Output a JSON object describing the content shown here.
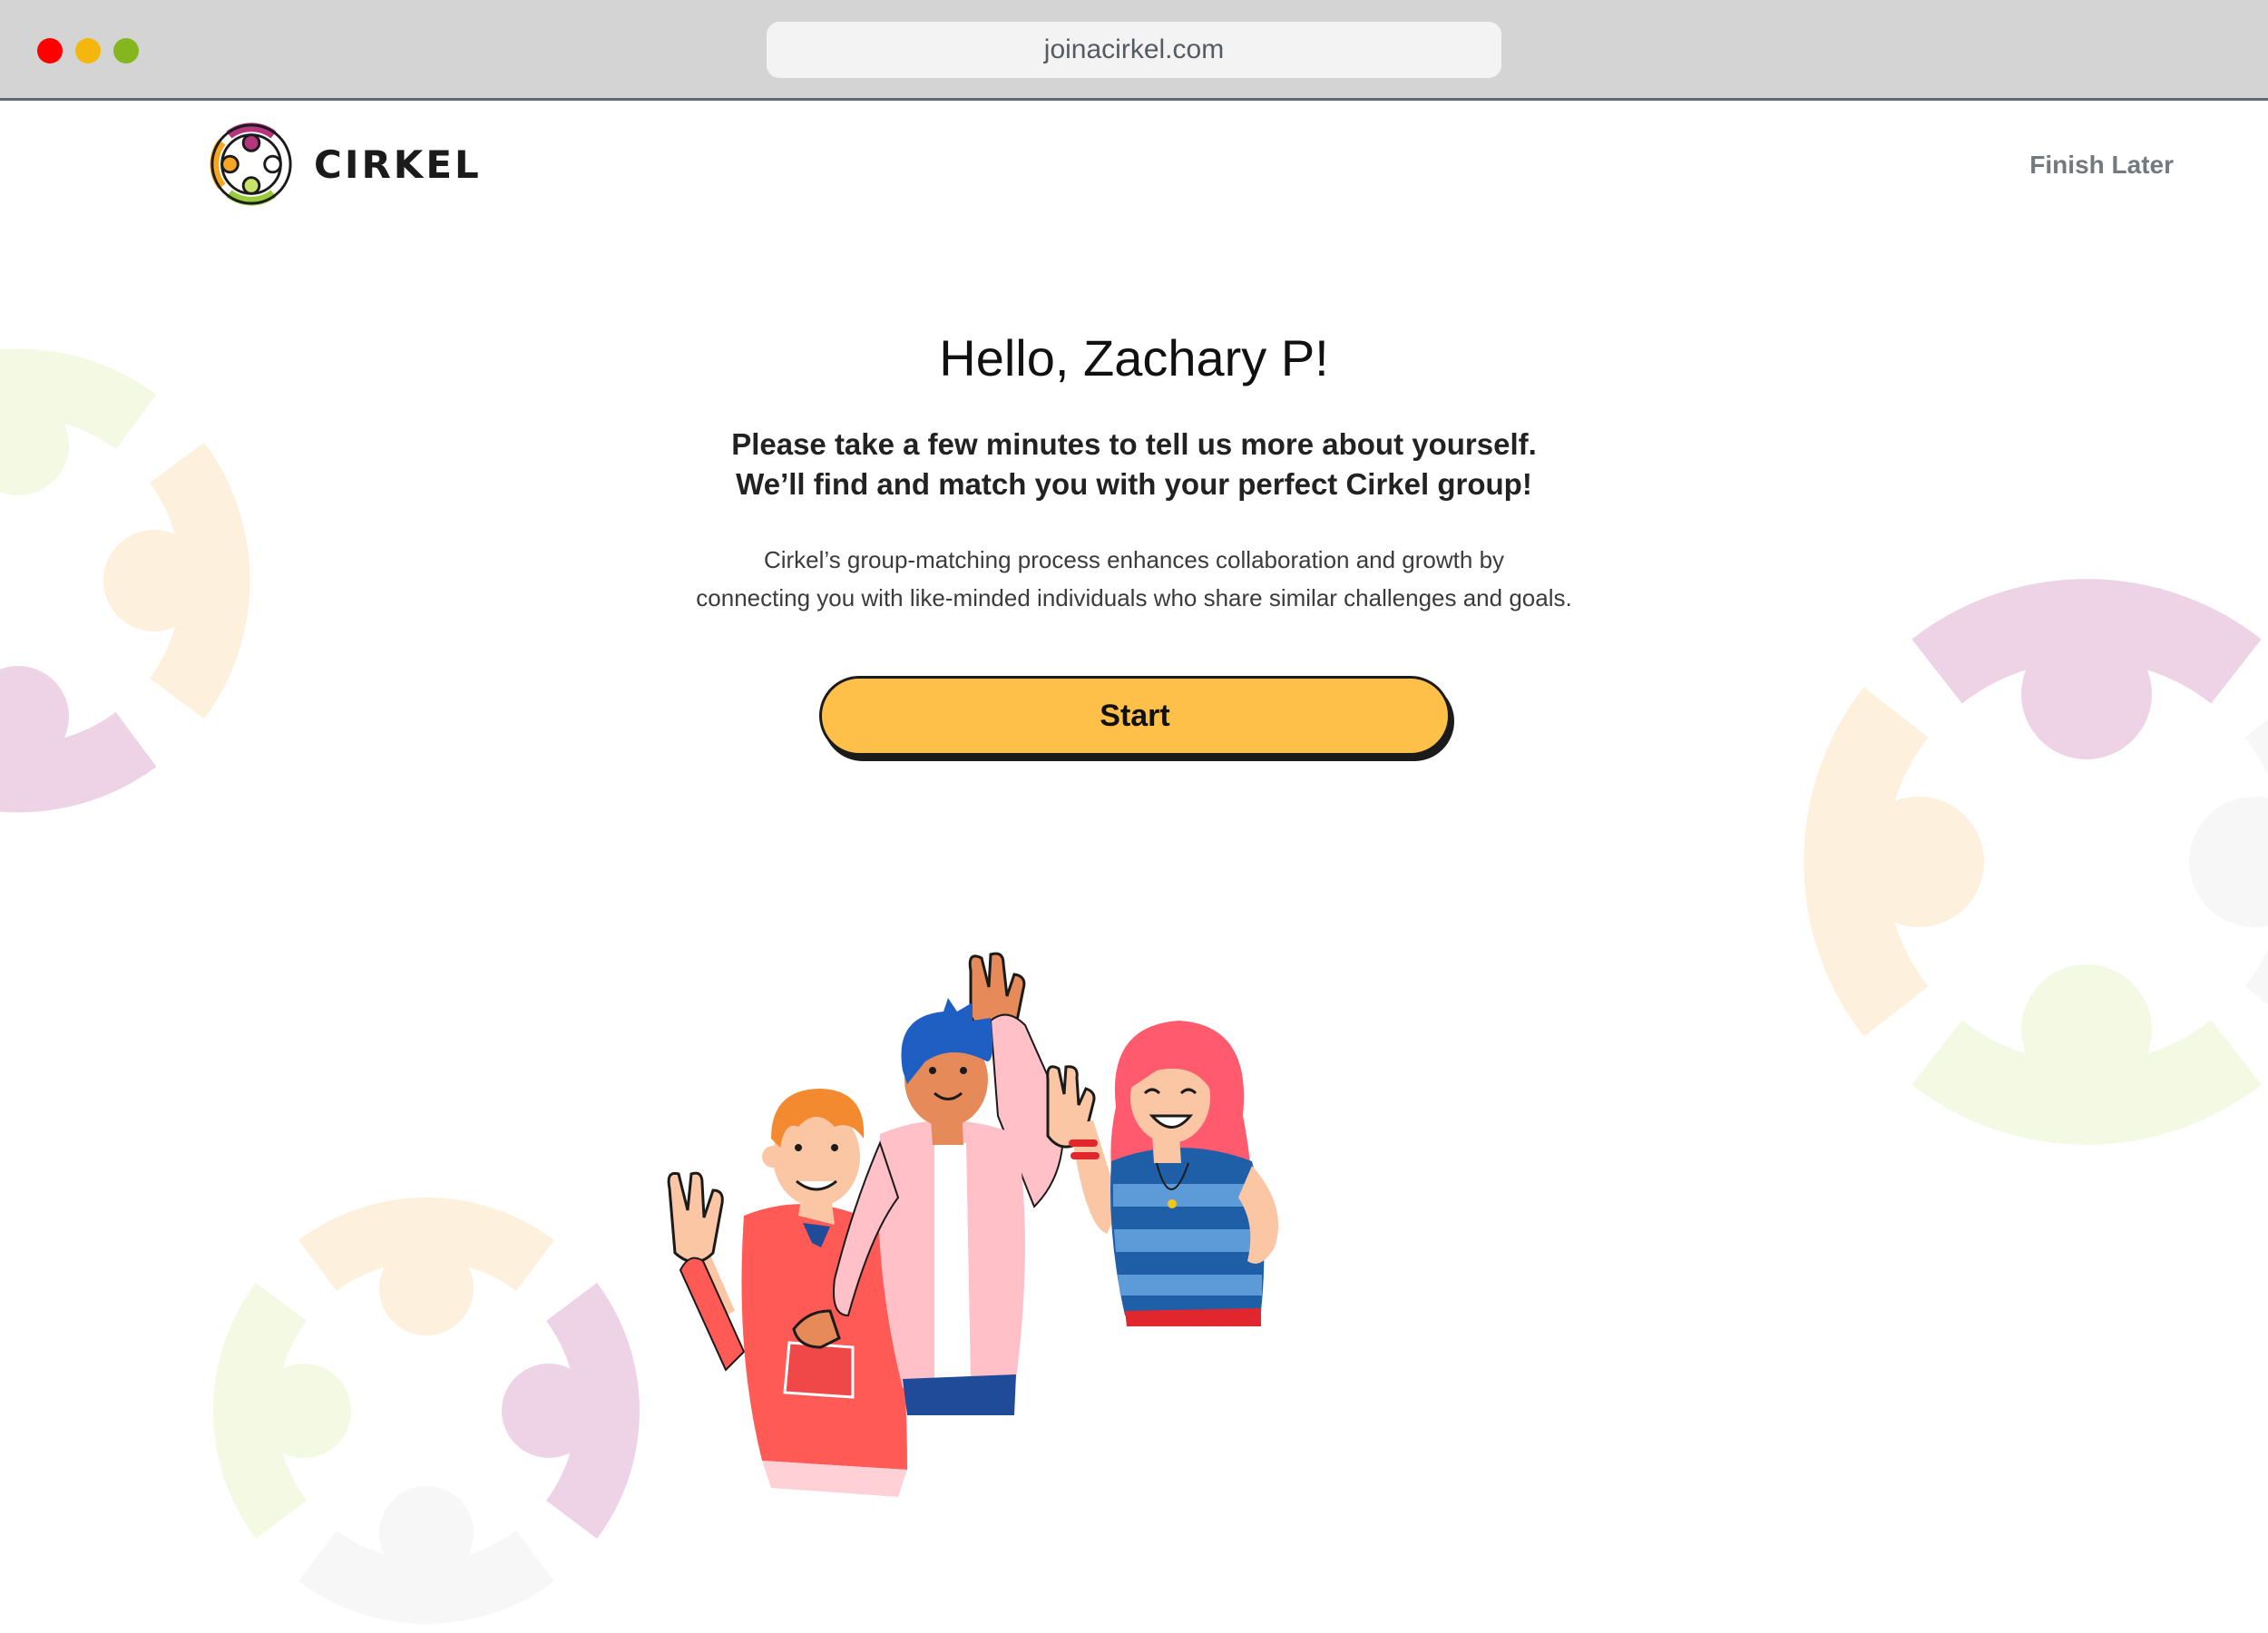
{
  "browser": {
    "url": "joinacirkel.com"
  },
  "header": {
    "logo_text": "CIRKEL",
    "finish_later": "Finish Later"
  },
  "main": {
    "greeting": "Hello, Zachary P!",
    "subtitle_line1": "Please take a few minutes to tell us more about yourself.",
    "subtitle_line2": "We’ll find and match you with your perfect Cirkel group!",
    "description_line1": "Cirkel’s group-matching process enhances collaboration and growth by",
    "description_line2": "connecting you with like-minded individuals who share similar challenges and goals.",
    "start_label": "Start"
  },
  "colors": {
    "accent_yellow": "#fec049",
    "deco_pink": "#eed3e6",
    "deco_peach": "#fdf0dd",
    "deco_lime": "#f3f9e3",
    "deco_gray": "#f7f7f7"
  }
}
